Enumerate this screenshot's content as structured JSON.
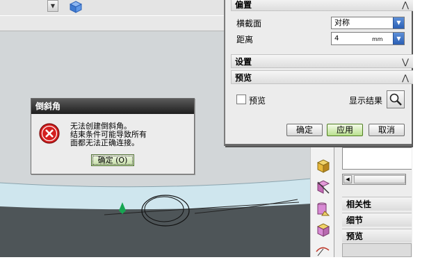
{
  "chamfer_dialog": {
    "offset_section": {
      "title": "偏置"
    },
    "cross_section": {
      "label": "横截面",
      "value": "对称"
    },
    "distance": {
      "label": "距离",
      "value": "4",
      "unit": "mm"
    },
    "settings_section": {
      "title": "设置"
    },
    "preview_section": {
      "title": "预览"
    },
    "preview_checkbox_label": "预览",
    "show_result_label": "显示结果",
    "buttons": {
      "ok": "确定",
      "apply": "应用",
      "cancel": "取消"
    }
  },
  "error_dialog": {
    "title": "倒斜角",
    "message_lines": [
      "无法创建倒斜角。",
      "结束条件可能导致所有",
      "面都无法正确连接。"
    ],
    "ok_label": "确定 (O)"
  },
  "right_panel": {
    "sections": [
      "相关性",
      "细节",
      "预览"
    ]
  },
  "icons": [
    "cube-icon",
    "dropdown-arrow-icon",
    "error-icon",
    "magnify-icon",
    "chevron-up-icon",
    "chevron-down-icon",
    "scroll-left-icon"
  ],
  "colors": {
    "accent_blue": "#2a5fb4",
    "apply_green": "#b9e08e",
    "error_red": "#d41f1f",
    "viewport_dark": "#4e5558",
    "viewport_light": "#cfe6ee"
  }
}
